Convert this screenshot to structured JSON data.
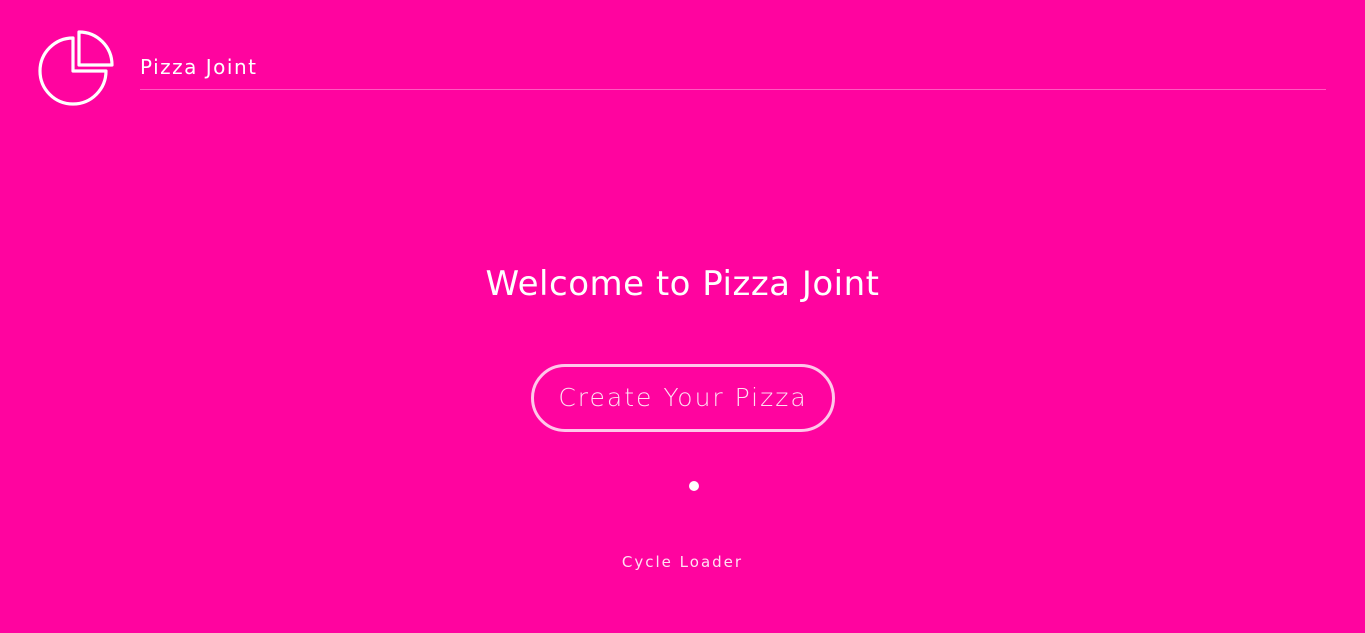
{
  "header": {
    "brand_name": "Pizza Joint",
    "logo_icon": "pie-chart-icon"
  },
  "main": {
    "title": "Welcome to Pizza Joint",
    "cta_label": "Create Your Pizza"
  },
  "loader": {
    "label": "Cycle Loader",
    "icon": "loader-dot"
  },
  "colors": {
    "background": "#ff049f",
    "foreground": "#ffffff"
  }
}
